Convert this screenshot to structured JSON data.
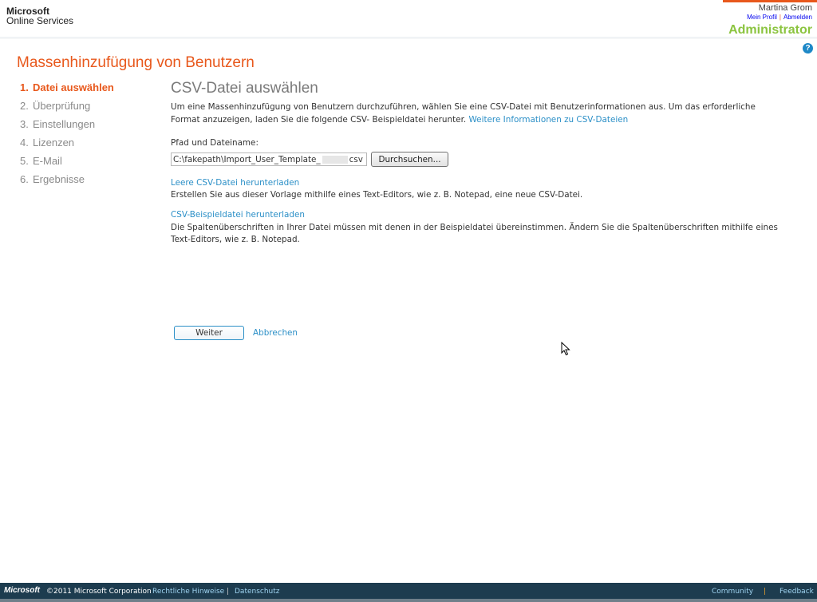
{
  "header": {
    "logo_line1": "Microsoft",
    "logo_line2": "Online Services",
    "user_name": "Martina Grom",
    "profile_link": "Mein Profil",
    "link_separator": "|",
    "logout_link": "Abmelden",
    "role": "Administrator",
    "help_label": "?"
  },
  "page": {
    "title": "Massenhinzufügung von Benutzern"
  },
  "steps": [
    {
      "num": "1.",
      "label": "Datei auswählen",
      "active": true
    },
    {
      "num": "2.",
      "label": "Überprüfung",
      "active": false
    },
    {
      "num": "3.",
      "label": "Einstellungen",
      "active": false
    },
    {
      "num": "4.",
      "label": "Lizenzen",
      "active": false
    },
    {
      "num": "5.",
      "label": "E-Mail",
      "active": false
    },
    {
      "num": "6.",
      "label": "Ergebnisse",
      "active": false
    }
  ],
  "main": {
    "section_title": "CSV-Datei auswählen",
    "intro_text": "Um eine Massenhinzufügung von Benutzern durchzuführen, wählen Sie eine CSV-Datei mit Benutzerinformationen aus. Um das erforderliche Format anzuzeigen, laden Sie die folgende CSV- Beispieldatei herunter.",
    "intro_link": "Weitere Informationen zu CSV-Dateien",
    "path_label": "Pfad und Dateiname:",
    "path_value_prefix": "C:\\fakepath\\Import_User_Template_",
    "path_value_suffix": "csv",
    "browse_button": "Durchsuchen...",
    "empty_csv_link": "Leere CSV-Datei herunterladen",
    "empty_csv_desc": "Erstellen Sie aus dieser Vorlage mithilfe eines Text-Editors, wie z. B. Notepad, eine neue CSV-Datei.",
    "sample_csv_link": "CSV-Beispieldatei herunterladen",
    "sample_csv_desc": "Die Spaltenüberschriften in Ihrer Datei müssen mit denen in der Beispieldatei übereinstimmen. Ändern Sie die Spaltenüberschriften mithilfe eines Text-Editors, wie z. B. Notepad.",
    "next_button": "Weiter",
    "cancel_link": "Abbrechen"
  },
  "footer": {
    "logo": "Microsoft",
    "copyright": "©2011 Microsoft Corporation",
    "legal_link": "Rechtliche Hinweise",
    "separator": "|",
    "privacy_link": "Datenschutz",
    "community_link": "Community",
    "feedback_link": "Feedback"
  },
  "colors": {
    "accent_orange": "#e8581c",
    "role_green": "#8bc43f",
    "link_blue": "#2b8fc7",
    "footer_bg": "#1d3c4f"
  }
}
